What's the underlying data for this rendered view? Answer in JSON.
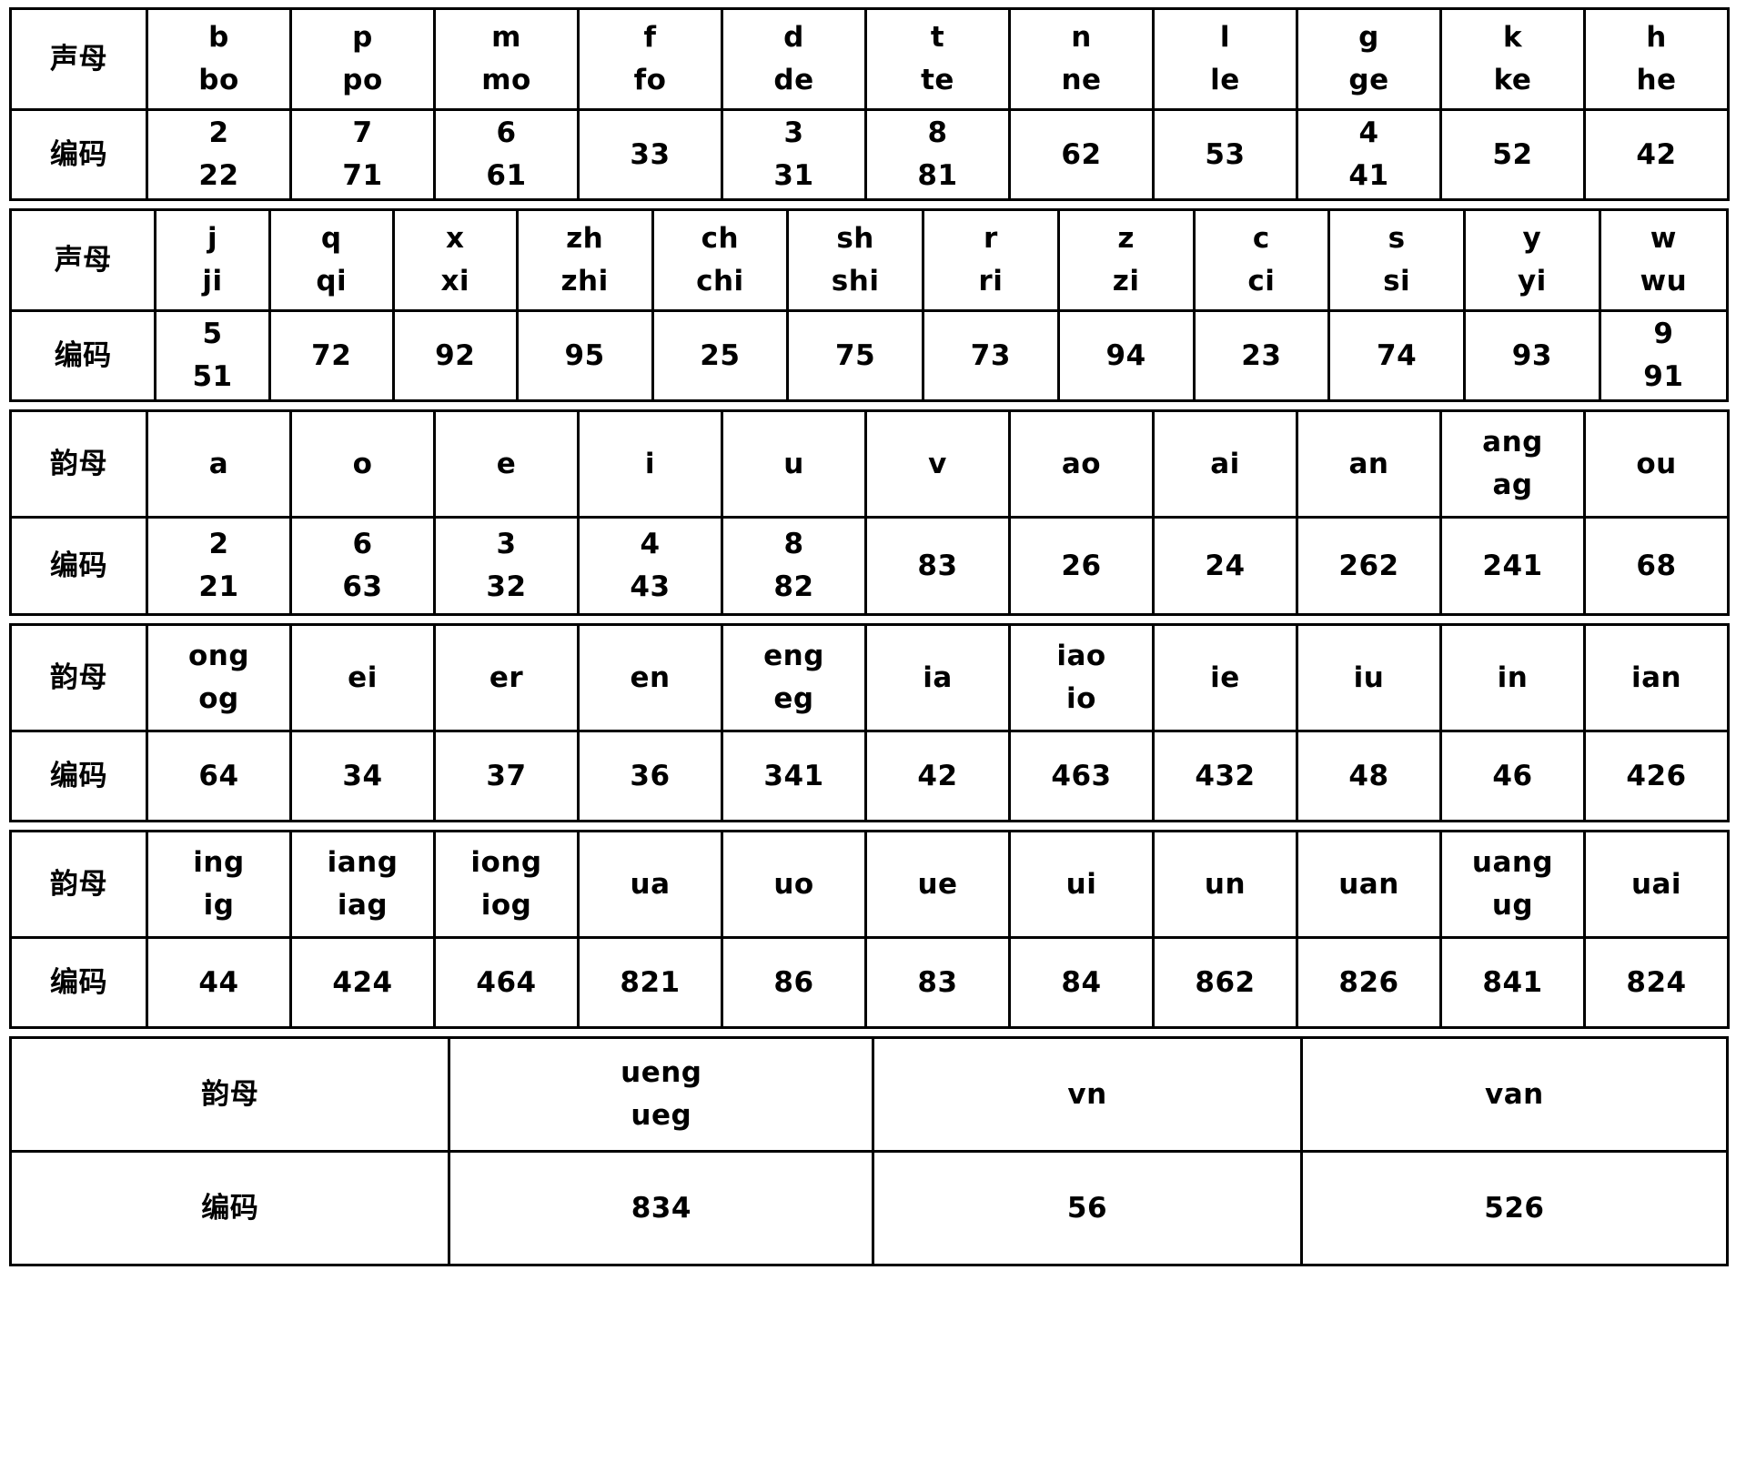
{
  "labels": {
    "initial": "声母",
    "final": "韵母",
    "code": "编码"
  },
  "table": {
    "blocks": [
      {
        "header_label": "声母",
        "code_label": "编码",
        "items": [
          {
            "top": "b",
            "bottom": "bo"
          },
          {
            "top": "p",
            "bottom": "po"
          },
          {
            "top": "m",
            "bottom": "mo"
          },
          {
            "top": "f",
            "bottom": "fo"
          },
          {
            "top": "d",
            "bottom": "de"
          },
          {
            "top": "t",
            "bottom": "te"
          },
          {
            "top": "n",
            "bottom": "ne"
          },
          {
            "top": "l",
            "bottom": "le"
          },
          {
            "top": "g",
            "bottom": "ge"
          },
          {
            "top": "k",
            "bottom": "ke"
          },
          {
            "top": "h",
            "bottom": "he"
          }
        ],
        "codes": [
          {
            "top": "2",
            "bottom": "22"
          },
          {
            "top": "7",
            "bottom": "71"
          },
          {
            "top": "6",
            "bottom": "61"
          },
          {
            "top": "33",
            "bottom": ""
          },
          {
            "top": "3",
            "bottom": "31"
          },
          {
            "top": "8",
            "bottom": "81"
          },
          {
            "top": "62",
            "bottom": ""
          },
          {
            "top": "53",
            "bottom": ""
          },
          {
            "top": "4",
            "bottom": "41"
          },
          {
            "top": "52",
            "bottom": ""
          },
          {
            "top": "42",
            "bottom": ""
          }
        ]
      },
      {
        "header_label": "声母",
        "code_label": "编码",
        "items": [
          {
            "top": "j",
            "bottom": "ji"
          },
          {
            "top": "q",
            "bottom": "qi"
          },
          {
            "top": "x",
            "bottom": "xi"
          },
          {
            "top": "zh",
            "bottom": "zhi"
          },
          {
            "top": "ch",
            "bottom": "chi"
          },
          {
            "top": "sh",
            "bottom": "shi"
          },
          {
            "top": "r",
            "bottom": "ri"
          },
          {
            "top": "z",
            "bottom": "zi"
          },
          {
            "top": "c",
            "bottom": "ci"
          },
          {
            "top": "s",
            "bottom": "si"
          },
          {
            "top": "y",
            "bottom": "yi"
          },
          {
            "top": "w",
            "bottom": "wu"
          }
        ],
        "codes": [
          {
            "top": "5",
            "bottom": "51"
          },
          {
            "top": "72",
            "bottom": ""
          },
          {
            "top": "92",
            "bottom": ""
          },
          {
            "top": "95",
            "bottom": ""
          },
          {
            "top": "25",
            "bottom": ""
          },
          {
            "top": "75",
            "bottom": ""
          },
          {
            "top": "73",
            "bottom": ""
          },
          {
            "top": "94",
            "bottom": ""
          },
          {
            "top": "23",
            "bottom": ""
          },
          {
            "top": "74",
            "bottom": ""
          },
          {
            "top": "93",
            "bottom": ""
          },
          {
            "top": "9",
            "bottom": "91"
          }
        ]
      },
      {
        "header_label": "韵母",
        "code_label": "编码",
        "items": [
          {
            "top": "a",
            "bottom": ""
          },
          {
            "top": "o",
            "bottom": ""
          },
          {
            "top": "e",
            "bottom": ""
          },
          {
            "top": "i",
            "bottom": ""
          },
          {
            "top": "u",
            "bottom": ""
          },
          {
            "top": "v",
            "bottom": ""
          },
          {
            "top": "ao",
            "bottom": ""
          },
          {
            "top": "ai",
            "bottom": ""
          },
          {
            "top": "an",
            "bottom": ""
          },
          {
            "top": "ang",
            "bottom": "ag"
          },
          {
            "top": "ou",
            "bottom": ""
          }
        ],
        "codes": [
          {
            "top": "2",
            "bottom": "21"
          },
          {
            "top": "6",
            "bottom": "63"
          },
          {
            "top": "3",
            "bottom": "32"
          },
          {
            "top": "4",
            "bottom": "43"
          },
          {
            "top": "8",
            "bottom": "82"
          },
          {
            "top": "83",
            "bottom": ""
          },
          {
            "top": "26",
            "bottom": ""
          },
          {
            "top": "24",
            "bottom": ""
          },
          {
            "top": "262",
            "bottom": ""
          },
          {
            "top": "241",
            "bottom": ""
          },
          {
            "top": "68",
            "bottom": ""
          }
        ]
      },
      {
        "header_label": "韵母",
        "code_label": "编码",
        "items": [
          {
            "top": "ong",
            "bottom": "og"
          },
          {
            "top": "ei",
            "bottom": ""
          },
          {
            "top": "er",
            "bottom": ""
          },
          {
            "top": "en",
            "bottom": ""
          },
          {
            "top": "eng",
            "bottom": "eg"
          },
          {
            "top": "ia",
            "bottom": ""
          },
          {
            "top": "iao",
            "bottom": "io"
          },
          {
            "top": "ie",
            "bottom": ""
          },
          {
            "top": "iu",
            "bottom": ""
          },
          {
            "top": "in",
            "bottom": ""
          },
          {
            "top": "ian",
            "bottom": ""
          }
        ],
        "codes": [
          {
            "top": "64",
            "bottom": ""
          },
          {
            "top": "34",
            "bottom": ""
          },
          {
            "top": "37",
            "bottom": ""
          },
          {
            "top": "36",
            "bottom": ""
          },
          {
            "top": "341",
            "bottom": ""
          },
          {
            "top": "42",
            "bottom": ""
          },
          {
            "top": "463",
            "bottom": ""
          },
          {
            "top": "432",
            "bottom": ""
          },
          {
            "top": "48",
            "bottom": ""
          },
          {
            "top": "46",
            "bottom": ""
          },
          {
            "top": "426",
            "bottom": ""
          }
        ]
      },
      {
        "header_label": "韵母",
        "code_label": "编码",
        "items": [
          {
            "top": "ing",
            "bottom": "ig"
          },
          {
            "top": "iang",
            "bottom": "iag"
          },
          {
            "top": "iong",
            "bottom": "iog"
          },
          {
            "top": "ua",
            "bottom": ""
          },
          {
            "top": "uo",
            "bottom": ""
          },
          {
            "top": "ue",
            "bottom": ""
          },
          {
            "top": "ui",
            "bottom": ""
          },
          {
            "top": "un",
            "bottom": ""
          },
          {
            "top": "uan",
            "bottom": ""
          },
          {
            "top": "uang",
            "bottom": "ug"
          },
          {
            "top": "uai",
            "bottom": ""
          }
        ],
        "codes": [
          {
            "top": "44",
            "bottom": ""
          },
          {
            "top": "424",
            "bottom": ""
          },
          {
            "top": "464",
            "bottom": ""
          },
          {
            "top": "821",
            "bottom": ""
          },
          {
            "top": "86",
            "bottom": ""
          },
          {
            "top": "83",
            "bottom": ""
          },
          {
            "top": "84",
            "bottom": ""
          },
          {
            "top": "862",
            "bottom": ""
          },
          {
            "top": "826",
            "bottom": ""
          },
          {
            "top": "841",
            "bottom": ""
          },
          {
            "top": "824",
            "bottom": ""
          }
        ]
      }
    ],
    "tail": {
      "header_label": "韵母",
      "code_label": "编码",
      "items": [
        {
          "top": "ueng",
          "bottom": "ueg"
        },
        {
          "top": "vn",
          "bottom": ""
        },
        {
          "top": "van",
          "bottom": ""
        }
      ],
      "codes": [
        {
          "top": "834",
          "bottom": ""
        },
        {
          "top": "56",
          "bottom": ""
        },
        {
          "top": "526",
          "bottom": ""
        }
      ]
    }
  }
}
